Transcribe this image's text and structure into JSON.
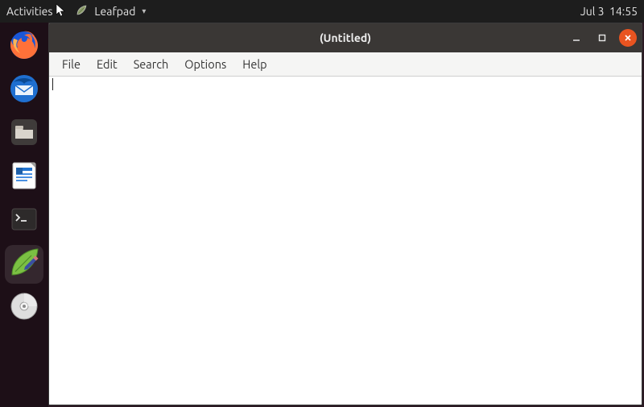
{
  "panel": {
    "activities": "Activities",
    "appmenu_label": "Leafpad",
    "date": "Jul 3",
    "time": "14:55"
  },
  "dock": {
    "items": [
      {
        "name": "firefox",
        "active": false
      },
      {
        "name": "thunderbird",
        "active": false
      },
      {
        "name": "files",
        "active": false
      },
      {
        "name": "libreoffice-writer",
        "active": false
      },
      {
        "name": "terminal",
        "active": false
      },
      {
        "name": "leafpad",
        "active": true
      },
      {
        "name": "disc-burner",
        "active": false
      }
    ]
  },
  "window": {
    "title": "(Untitled)",
    "menubar": {
      "file": "File",
      "edit": "Edit",
      "search": "Search",
      "options": "Options",
      "help": "Help"
    },
    "editor": {
      "content": "",
      "placeholder": ""
    },
    "controls": {
      "minimize": "minimize",
      "maximize": "maximize",
      "close": "close"
    }
  },
  "colors": {
    "close_button": "#e95420",
    "titlebar": "#3a3735",
    "panel": "#1d1d1d"
  }
}
